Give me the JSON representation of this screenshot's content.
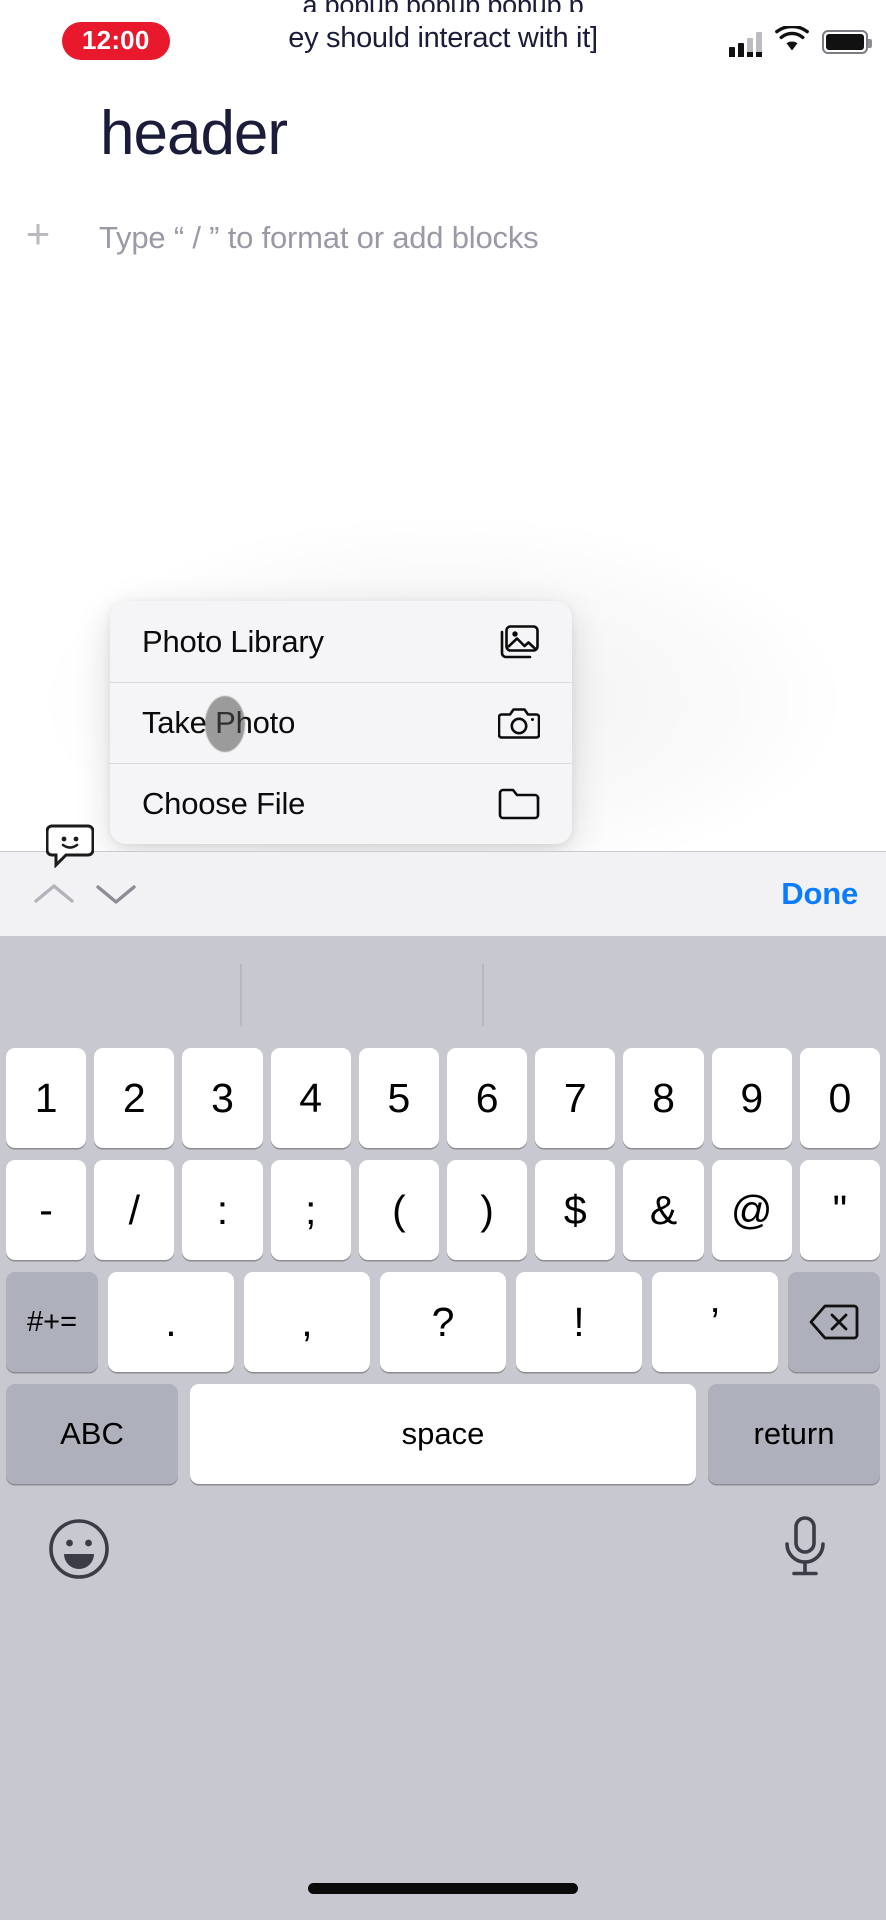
{
  "clipped_top_text": "a popup popup popup p",
  "status_bar": {
    "time": "12:00",
    "notification_text": "ey should interact with it]",
    "icons": [
      "cellular-signal-icon",
      "wifi-icon",
      "battery-icon"
    ]
  },
  "document": {
    "title": "header",
    "add_block_icon": "plus-icon",
    "placeholder": "Type “ / ” to format or add blocks"
  },
  "action_sheet": {
    "items": [
      {
        "label": "Photo Library",
        "icon": "photo-library-icon"
      },
      {
        "label": "Take Photo",
        "icon": "camera-icon"
      },
      {
        "label": "Choose File",
        "icon": "folder-icon"
      }
    ]
  },
  "keyboard_toolbar": {
    "prev_icon": "chevron-up-icon",
    "next_icon": "chevron-down-icon",
    "done_label": "Done",
    "done_color": "#0a7cff"
  },
  "keyboard": {
    "layout": "numeric-symbols",
    "row1": [
      "1",
      "2",
      "3",
      "4",
      "5",
      "6",
      "7",
      "8",
      "9",
      "0"
    ],
    "row2": [
      "-",
      "/",
      ":",
      ";",
      "(",
      ")",
      "$",
      "&",
      "@",
      "\""
    ],
    "row3": {
      "shift_label": "#+=",
      "keys": [
        ".",
        ",",
        "?",
        "!",
        "’"
      ],
      "delete_icon": "backspace-icon"
    },
    "row4": {
      "abc_label": "ABC",
      "space_label": "space",
      "return_label": "return"
    },
    "bottom": {
      "emoji_icon": "emoji-face-icon",
      "mic_icon": "microphone-icon"
    }
  }
}
